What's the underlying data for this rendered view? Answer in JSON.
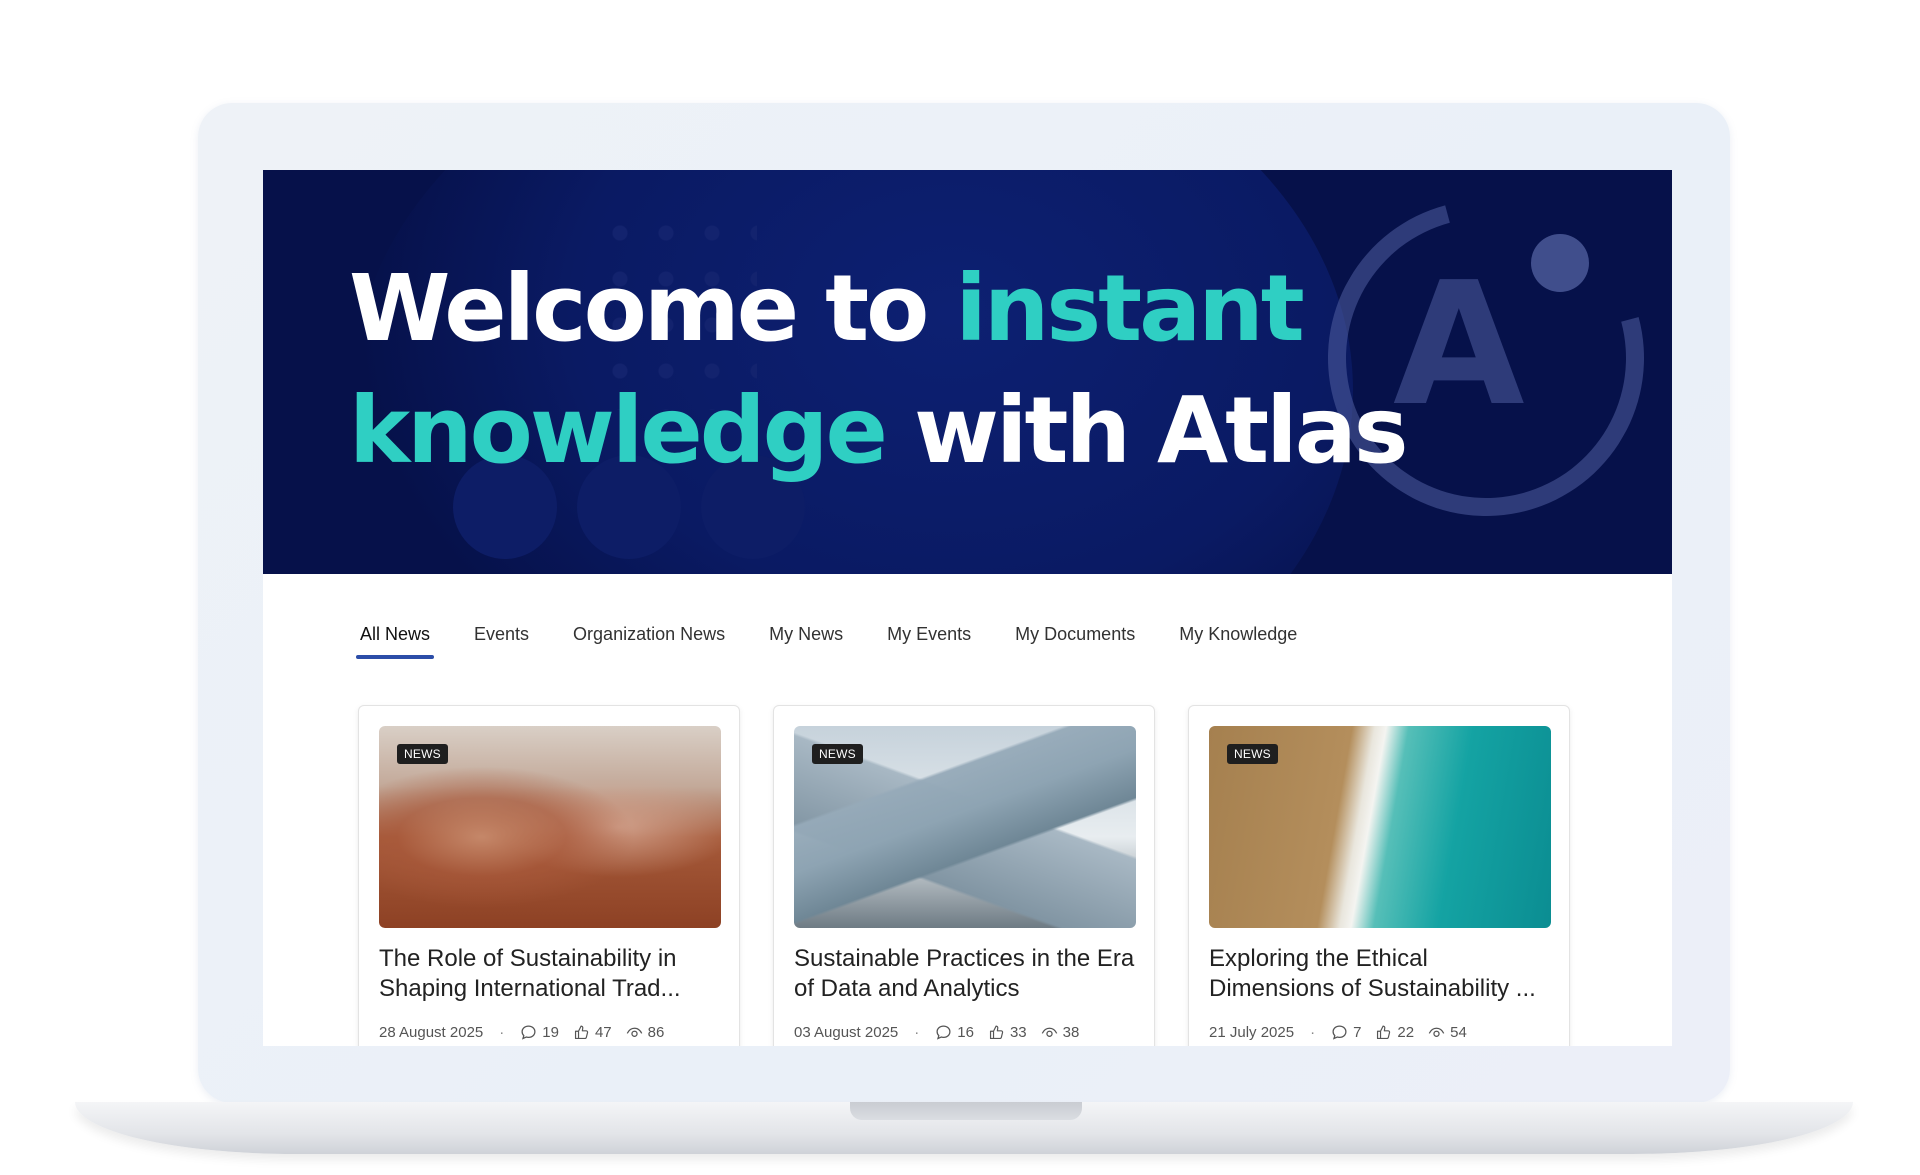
{
  "hero": {
    "title_part1": "Welcome to ",
    "title_accent1": "instant",
    "title_accent2": "knowledge",
    "title_part2": " with Atlas",
    "logo_letter": "A",
    "colors": {
      "background": "#06114a",
      "accent": "#2fcfc3"
    }
  },
  "tabs": [
    {
      "label": "All News",
      "active": true
    },
    {
      "label": "Events",
      "active": false
    },
    {
      "label": "Organization News",
      "active": false
    },
    {
      "label": "My News",
      "active": false
    },
    {
      "label": "My Events",
      "active": false
    },
    {
      "label": "My Documents",
      "active": false
    },
    {
      "label": "My Knowledge",
      "active": false
    }
  ],
  "cards": [
    {
      "badge": "NEWS",
      "title": "The Role of Sustainability in Shaping International Trad...",
      "date": "28 August 2025",
      "comments": "19",
      "likes": "47",
      "views": "86",
      "image": "desert-dust-storm"
    },
    {
      "badge": "NEWS",
      "title": "Sustainable Practices in the Era of Data and Analytics",
      "date": "03 August 2025",
      "comments": "16",
      "likes": "33",
      "views": "38",
      "image": "geometric-glass-building"
    },
    {
      "badge": "NEWS",
      "title": "Exploring the Ethical Dimensions of Sustainability ...",
      "date": "21 July 2025",
      "comments": "7",
      "likes": "22",
      "views": "54",
      "image": "aerial-beach-waves"
    }
  ],
  "meta_separator": "·",
  "icons": {
    "comment": "comment-icon",
    "like": "thumbs-up-icon",
    "view": "eye-icon"
  }
}
